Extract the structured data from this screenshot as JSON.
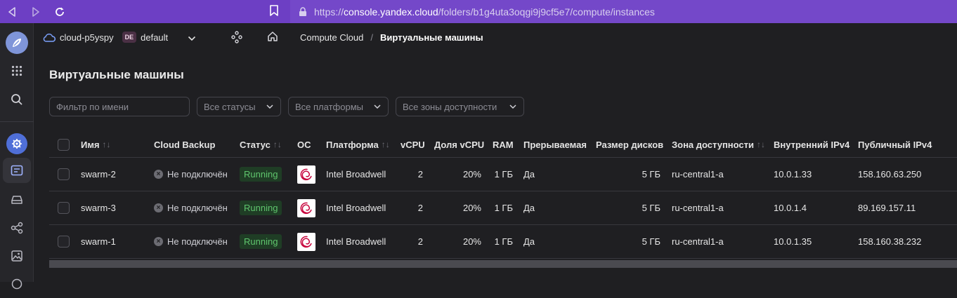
{
  "browser": {
    "url_prefix": "https://",
    "url_host": "console.yandex.cloud",
    "url_path": "/folders/b1g4uta3oqgi9j9cf5e7/compute/instances"
  },
  "topnav": {
    "cloud_name": "cloud-p5yspy",
    "folder_badge": "DE",
    "folder_name": "default",
    "breadcrumb_service": "Compute Cloud",
    "breadcrumb_sep": "/",
    "breadcrumb_current": "Виртуальные машины"
  },
  "page": {
    "title": "Виртуальные машины"
  },
  "filters": {
    "name_placeholder": "Фильтр по имени",
    "status": "Все статусы",
    "platform": "Все платформы",
    "zone": "Все зоны доступности"
  },
  "table": {
    "columns": {
      "name": "Имя",
      "backup": "Cloud Backup",
      "status": "Статус",
      "os": "ОС",
      "platform": "Платформа",
      "vcpu": "vCPU",
      "vcpu_share": "Доля vCPU",
      "ram": "RAM",
      "preemptible": "Прерываемая",
      "disk": "Размер дисков",
      "zone": "Зона доступности",
      "internal_ip": "Внутренний IPv4",
      "public_ip": "Публичный IPv4"
    },
    "rows": [
      {
        "name": "swarm-2",
        "backup": "Не подключён",
        "status": "Running",
        "platform": "Intel Broadwell",
        "vcpu": "2",
        "vcpu_share": "20%",
        "ram": "1 ГБ",
        "preemptible": "Да",
        "disk": "5 ГБ",
        "zone": "ru-central1-a",
        "internal_ip": "10.0.1.33",
        "public_ip": "158.160.63.250"
      },
      {
        "name": "swarm-3",
        "backup": "Не подключён",
        "status": "Running",
        "platform": "Intel Broadwell",
        "vcpu": "2",
        "vcpu_share": "20%",
        "ram": "1 ГБ",
        "preemptible": "Да",
        "disk": "5 ГБ",
        "zone": "ru-central1-a",
        "internal_ip": "10.0.1.4",
        "public_ip": "89.169.157.11"
      },
      {
        "name": "swarm-1",
        "backup": "Не подключён",
        "status": "Running",
        "platform": "Intel Broadwell",
        "vcpu": "2",
        "vcpu_share": "20%",
        "ram": "1 ГБ",
        "preemptible": "Да",
        "disk": "5 ГБ",
        "zone": "ru-central1-a",
        "internal_ip": "10.0.1.35",
        "public_ip": "158.160.38.232"
      }
    ]
  },
  "icons": {
    "os": "debian-logo-icon",
    "status_running_color": "#5fc56d",
    "browser_accent": "#6d3fc4"
  }
}
